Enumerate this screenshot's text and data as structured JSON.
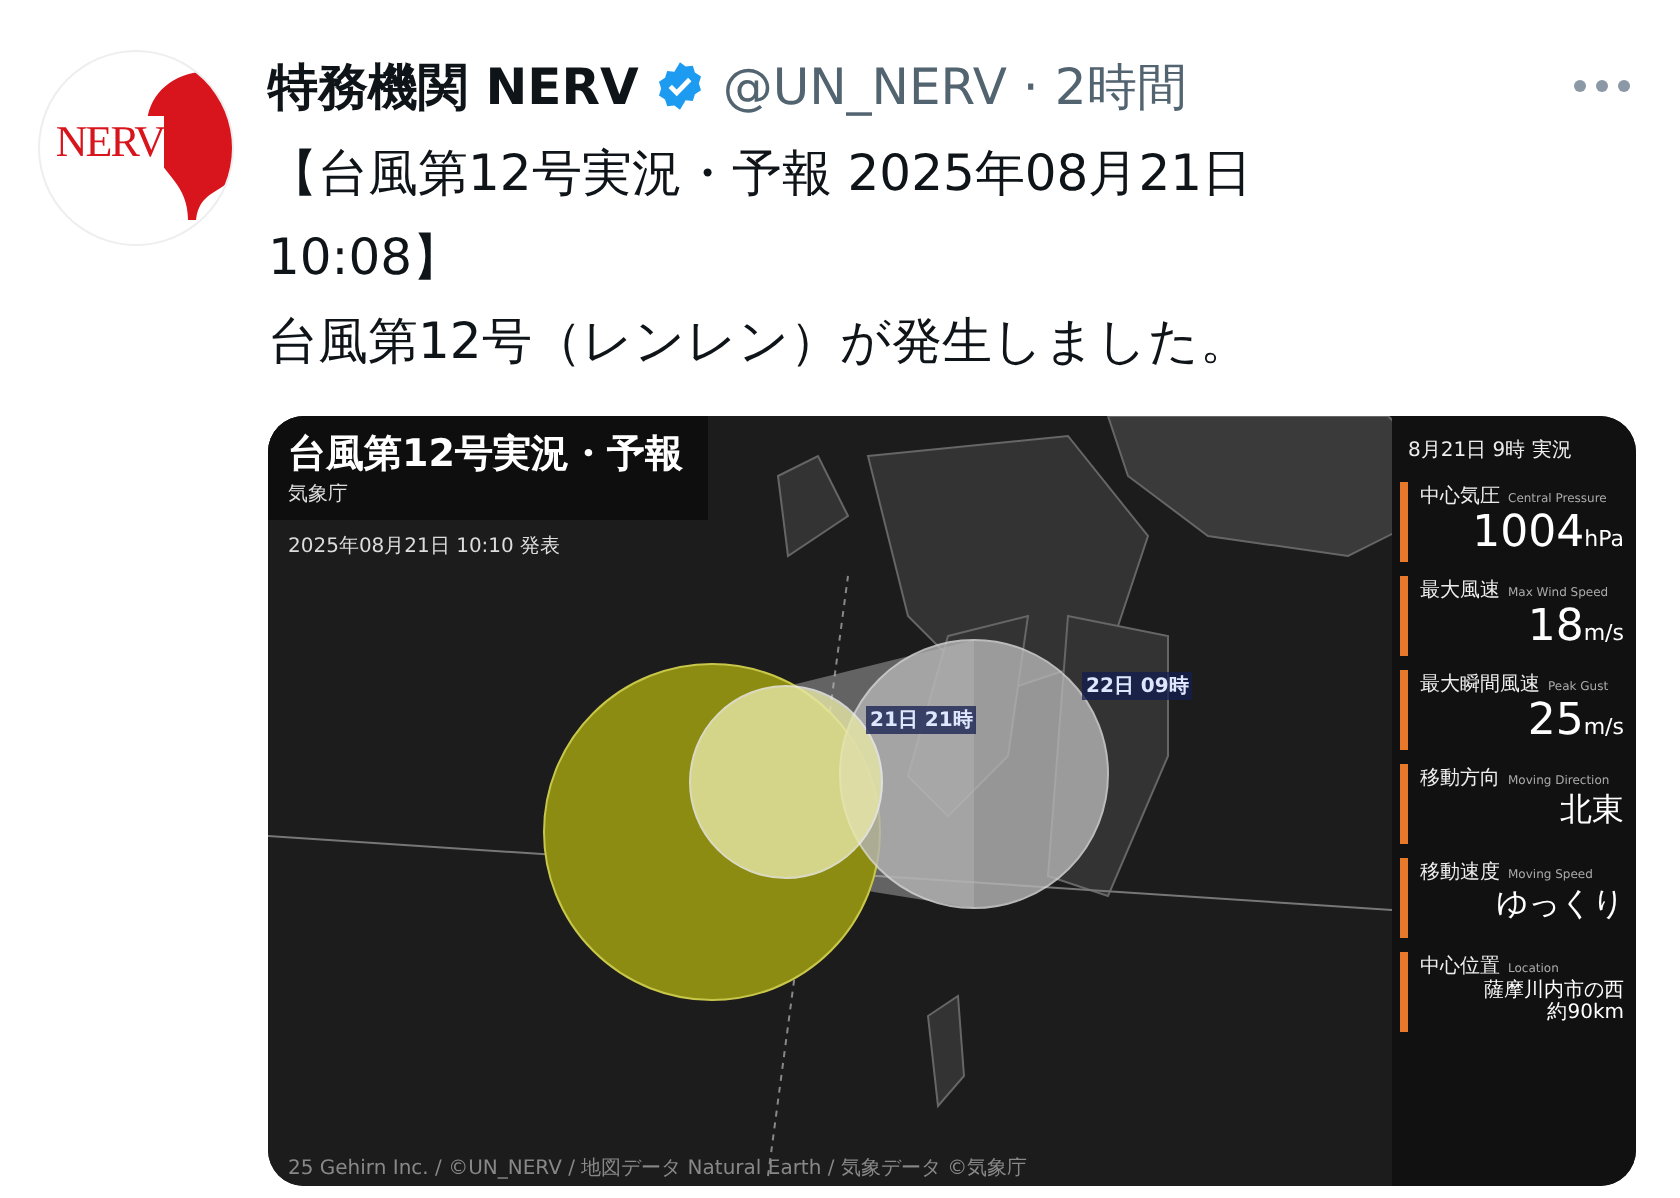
{
  "post": {
    "avatar": {
      "logo_text": "NERV"
    },
    "author": {
      "name": "特務機関 NERV",
      "verified": true,
      "handle": "@UN_NERV",
      "separator": "·",
      "time": "2時間"
    },
    "text": [
      "【台風第12号実況・予報 2025年08月21日 10:08】",
      "台風第12号（レンレン）が発生しました。"
    ],
    "card": {
      "title": "台風第12号実況・予報",
      "agency": "気象庁",
      "issued": "2025年08月21日 10:10 発表",
      "map_labels": [
        "21日 21時",
        "22日 09時"
      ],
      "credit": "25 Gehirn Inc. / ©UN_NERV / 地図データ Natural Earth / 気象データ ©気象庁",
      "panel": {
        "heading": "8月21日 9時 実況",
        "items": [
          {
            "kind": "large",
            "label": "中心気圧",
            "label_en": "Central Pressure",
            "value": "1004",
            "unit": "hPa"
          },
          {
            "kind": "large",
            "label": "最大風速",
            "label_en": "Max Wind Speed",
            "value": "18",
            "unit": "m/s"
          },
          {
            "kind": "large",
            "label": "最大瞬間風速",
            "label_en": "Peak Gust",
            "value": "25",
            "unit": "m/s"
          },
          {
            "kind": "text",
            "label": "移動方向",
            "label_en": "Moving Direction",
            "value": "北東"
          },
          {
            "kind": "text",
            "label": "移動速度",
            "label_en": "Moving Speed",
            "value": "ゆっくり"
          },
          {
            "kind": "small",
            "label": "中心位置",
            "label_en": "Location",
            "value_lines": [
              "薩摩川内市の西",
              "約90km"
            ]
          }
        ]
      }
    }
  }
}
